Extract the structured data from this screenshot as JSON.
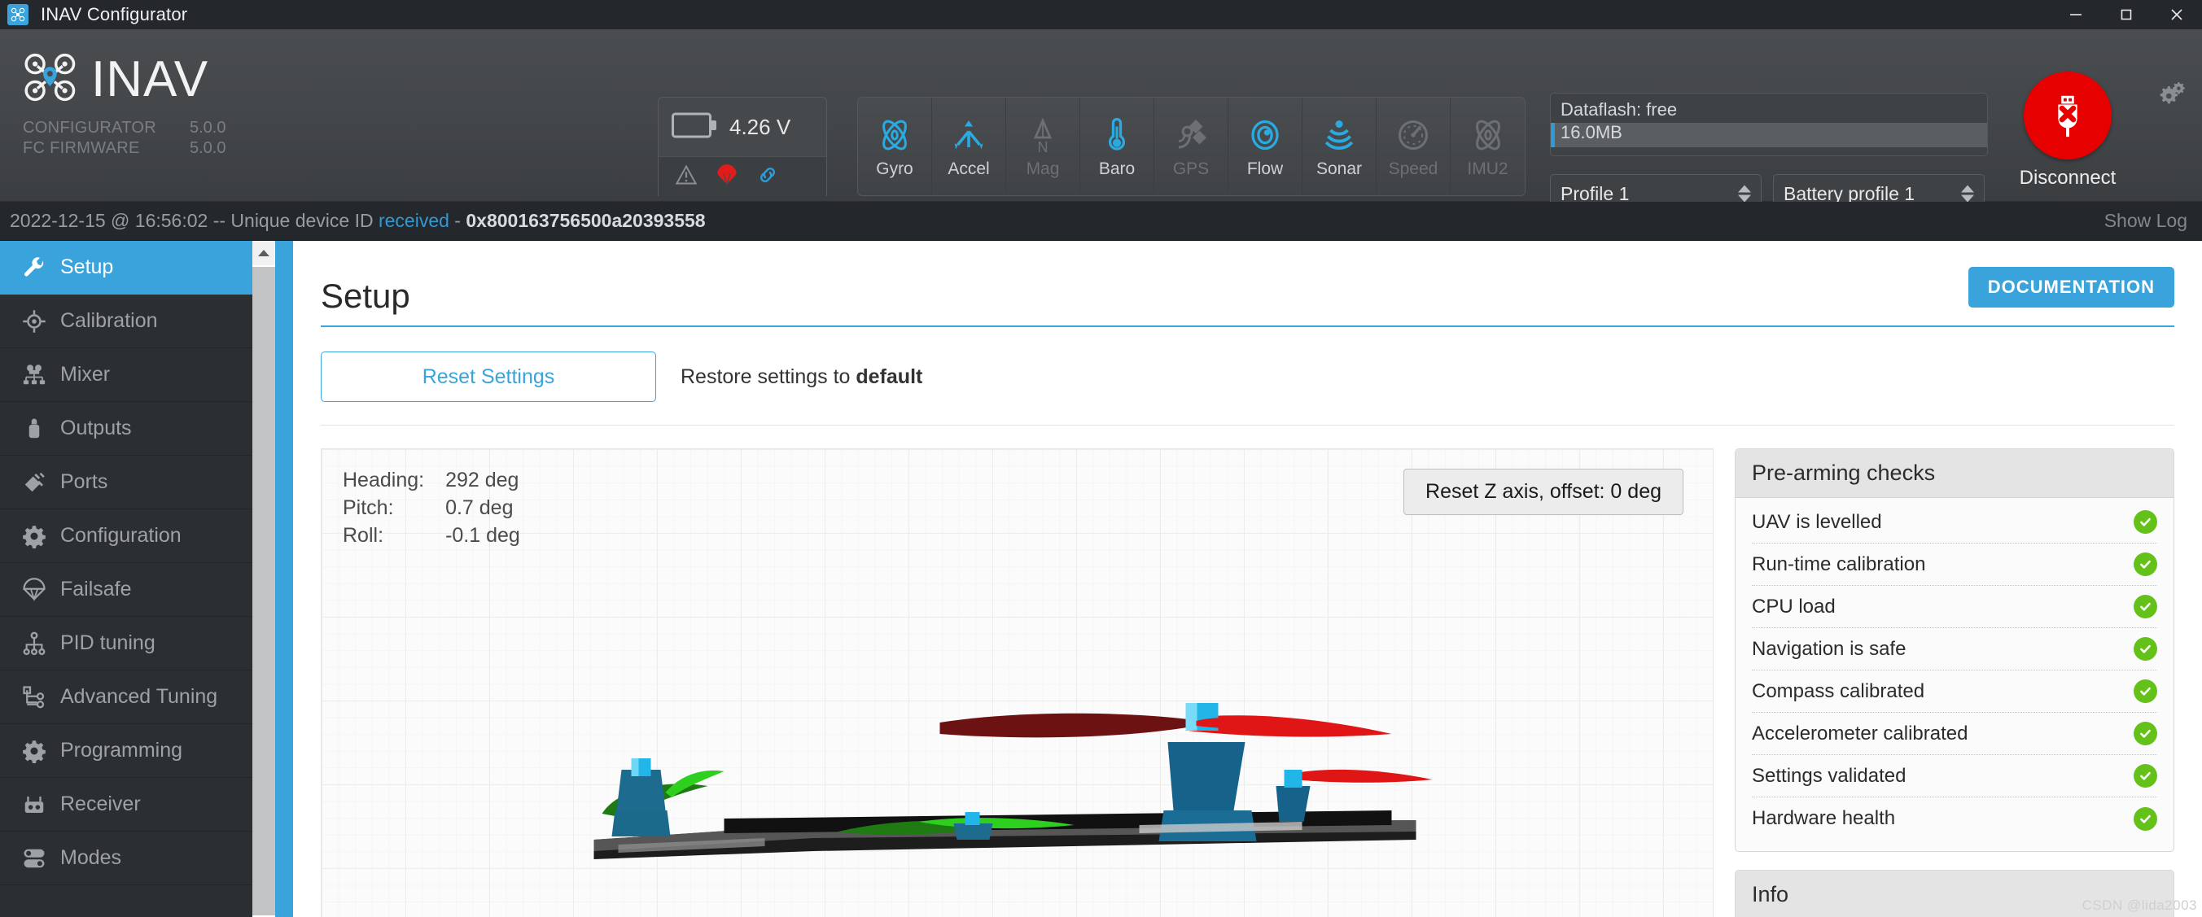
{
  "window": {
    "title": "INAV Configurator",
    "app_icon": "drone-icon",
    "minimize": "minimize-icon",
    "maximize": "maximize-icon",
    "close": "close-icon"
  },
  "brand": {
    "name": "INAV",
    "configurator_label": "CONFIGURATOR",
    "configurator_version": "5.0.0",
    "firmware_label": "FC FIRMWARE",
    "firmware_version": "5.0.0"
  },
  "battery": {
    "voltage": "4.26 V",
    "icon": "battery-icon",
    "flags": [
      {
        "name": "warning-icon",
        "state": "inactive",
        "color": "#8b8e91"
      },
      {
        "name": "parachute-icon",
        "state": "active",
        "color": "#e21b1b"
      },
      {
        "name": "link-icon",
        "state": "active",
        "color": "#2f9ad4"
      }
    ]
  },
  "sensors": [
    {
      "label": "Gyro",
      "icon": "gyro-icon",
      "active": true
    },
    {
      "label": "Accel",
      "icon": "accel-icon",
      "active": true
    },
    {
      "label": "Mag",
      "icon": "mag-icon",
      "active": false
    },
    {
      "label": "Baro",
      "icon": "baro-icon",
      "active": true
    },
    {
      "label": "GPS",
      "icon": "gps-icon",
      "active": false
    },
    {
      "label": "Flow",
      "icon": "flow-icon",
      "active": true
    },
    {
      "label": "Sonar",
      "icon": "sonar-icon",
      "active": true
    },
    {
      "label": "Speed",
      "icon": "speed-icon",
      "active": false
    },
    {
      "label": "IMU2",
      "icon": "imu2-icon",
      "active": false
    }
  ],
  "dataflash": {
    "label": "Dataflash: free",
    "value": "16.0MB",
    "fill_percent": 1
  },
  "profiles": {
    "profile": "Profile 1",
    "battery_profile": "Battery profile 1"
  },
  "connection": {
    "label": "Disconnect",
    "icon": "usb-disconnect-icon",
    "color": "#e60000"
  },
  "settings_gear": "gear-icon",
  "status": {
    "timestamp": "2022-12-15 @ 16:56:02",
    "separator": "--",
    "message": "Unique device ID",
    "highlight": "received",
    "dash": "-",
    "device_id": "0x800163756500a20393558",
    "show_log": "Show Log"
  },
  "sidebar": {
    "items": [
      {
        "label": "Setup",
        "icon": "wrench-icon",
        "active": true
      },
      {
        "label": "Calibration",
        "icon": "crosshair-icon",
        "active": false
      },
      {
        "label": "Mixer",
        "icon": "mixer-icon",
        "active": false
      },
      {
        "label": "Outputs",
        "icon": "outputs-icon",
        "active": false
      },
      {
        "label": "Ports",
        "icon": "plug-icon",
        "active": false
      },
      {
        "label": "Configuration",
        "icon": "gear-icon",
        "active": false
      },
      {
        "label": "Failsafe",
        "icon": "parachute-icon",
        "active": false
      },
      {
        "label": "PID tuning",
        "icon": "hierarchy-icon",
        "active": false
      },
      {
        "label": "Advanced Tuning",
        "icon": "nodes-icon",
        "active": false
      },
      {
        "label": "Programming",
        "icon": "gear-icon",
        "active": false
      },
      {
        "label": "Receiver",
        "icon": "transmitter-icon",
        "active": false
      },
      {
        "label": "Modes",
        "icon": "toggles-icon",
        "active": false
      }
    ],
    "scroll_up": "scroll-up-arrow"
  },
  "main": {
    "page_title": "Setup",
    "documentation_button": "DOCUMENTATION",
    "reset_button": "Reset Settings",
    "reset_description_prefix": "Restore settings to ",
    "reset_description_strong": "default"
  },
  "attitude": {
    "heading_label": "Heading:",
    "heading_value": "292 deg",
    "pitch_label": "Pitch:",
    "pitch_value": "0.7 deg",
    "roll_label": "Roll:",
    "roll_value": "-0.1 deg",
    "reset_z_button": "Reset Z axis, offset: 0 deg"
  },
  "prearming": {
    "title": "Pre-arming checks",
    "checks": [
      {
        "label": "UAV is levelled",
        "status": "ok"
      },
      {
        "label": "Run-time calibration",
        "status": "ok"
      },
      {
        "label": "CPU load",
        "status": "ok"
      },
      {
        "label": "Navigation is safe",
        "status": "ok"
      },
      {
        "label": "Compass calibrated",
        "status": "ok"
      },
      {
        "label": "Accelerometer calibrated",
        "status": "ok"
      },
      {
        "label": "Settings validated",
        "status": "ok"
      },
      {
        "label": "Hardware health",
        "status": "ok"
      }
    ],
    "ok_color": "#63c119"
  },
  "info": {
    "title": "Info"
  },
  "watermark": "CSDN @lida2003",
  "colors": {
    "accent": "#3ba3db",
    "dark_chrome": "#24272b",
    "toolbar": "#46494c",
    "sidebar": "#2c2f32",
    "danger": "#e60000",
    "success": "#63c119"
  }
}
